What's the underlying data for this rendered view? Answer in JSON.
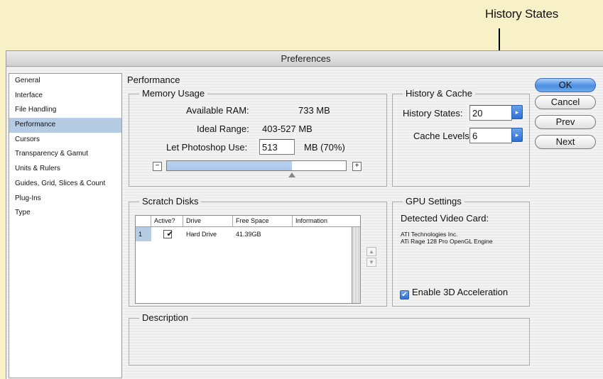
{
  "callout": {
    "label": "History States"
  },
  "window": {
    "title": "Preferences"
  },
  "sidebar": {
    "items": [
      {
        "label": "General"
      },
      {
        "label": "Interface"
      },
      {
        "label": "File Handling"
      },
      {
        "label": "Performance",
        "selected": true
      },
      {
        "label": "Cursors"
      },
      {
        "label": "Transparency & Gamut"
      },
      {
        "label": "Units & Rulers"
      },
      {
        "label": "Guides, Grid, Slices & Count"
      },
      {
        "label": "Plug-Ins"
      },
      {
        "label": "Type"
      }
    ]
  },
  "main": {
    "section_title": "Performance",
    "memory": {
      "legend": "Memory Usage",
      "available_label": "Available RAM:",
      "available_value": "733 MB",
      "ideal_label": "Ideal Range:",
      "ideal_value": "403-527 MB",
      "use_label": "Let Photoshop Use:",
      "use_value": "513",
      "use_unit": "MB (70%)",
      "minus": "−",
      "plus": "+",
      "slider_fraction": 0.7
    },
    "history": {
      "legend": "History & Cache",
      "states_label": "History States:",
      "states_value": "20",
      "cache_label": "Cache Levels:",
      "cache_value": "6"
    },
    "scratch": {
      "legend": "Scratch Disks",
      "columns": [
        "",
        "Active?",
        "Drive",
        "Free Space",
        "Information"
      ],
      "rows": [
        {
          "num": "1",
          "active": "✔",
          "drive": "Hard Drive",
          "free": "41.39GB",
          "info": ""
        }
      ],
      "up": "▲",
      "down": "▼"
    },
    "gpu": {
      "legend": "GPU Settings",
      "detected_label": "Detected Video Card:",
      "card_line1": "ATI Technologies Inc.",
      "card_line2": "ATi Rage 128 Pro OpenGL Engine",
      "enable_label": "Enable 3D Acceleration",
      "enabled_mark": "✔"
    },
    "description": {
      "legend": "Description"
    }
  },
  "buttons": {
    "ok": "OK",
    "cancel": "Cancel",
    "prev": "Prev",
    "next": "Next"
  },
  "colors": {
    "accent": "#4a8fe0",
    "selection": "#b6cbe4",
    "background": "#f8f1c8"
  }
}
